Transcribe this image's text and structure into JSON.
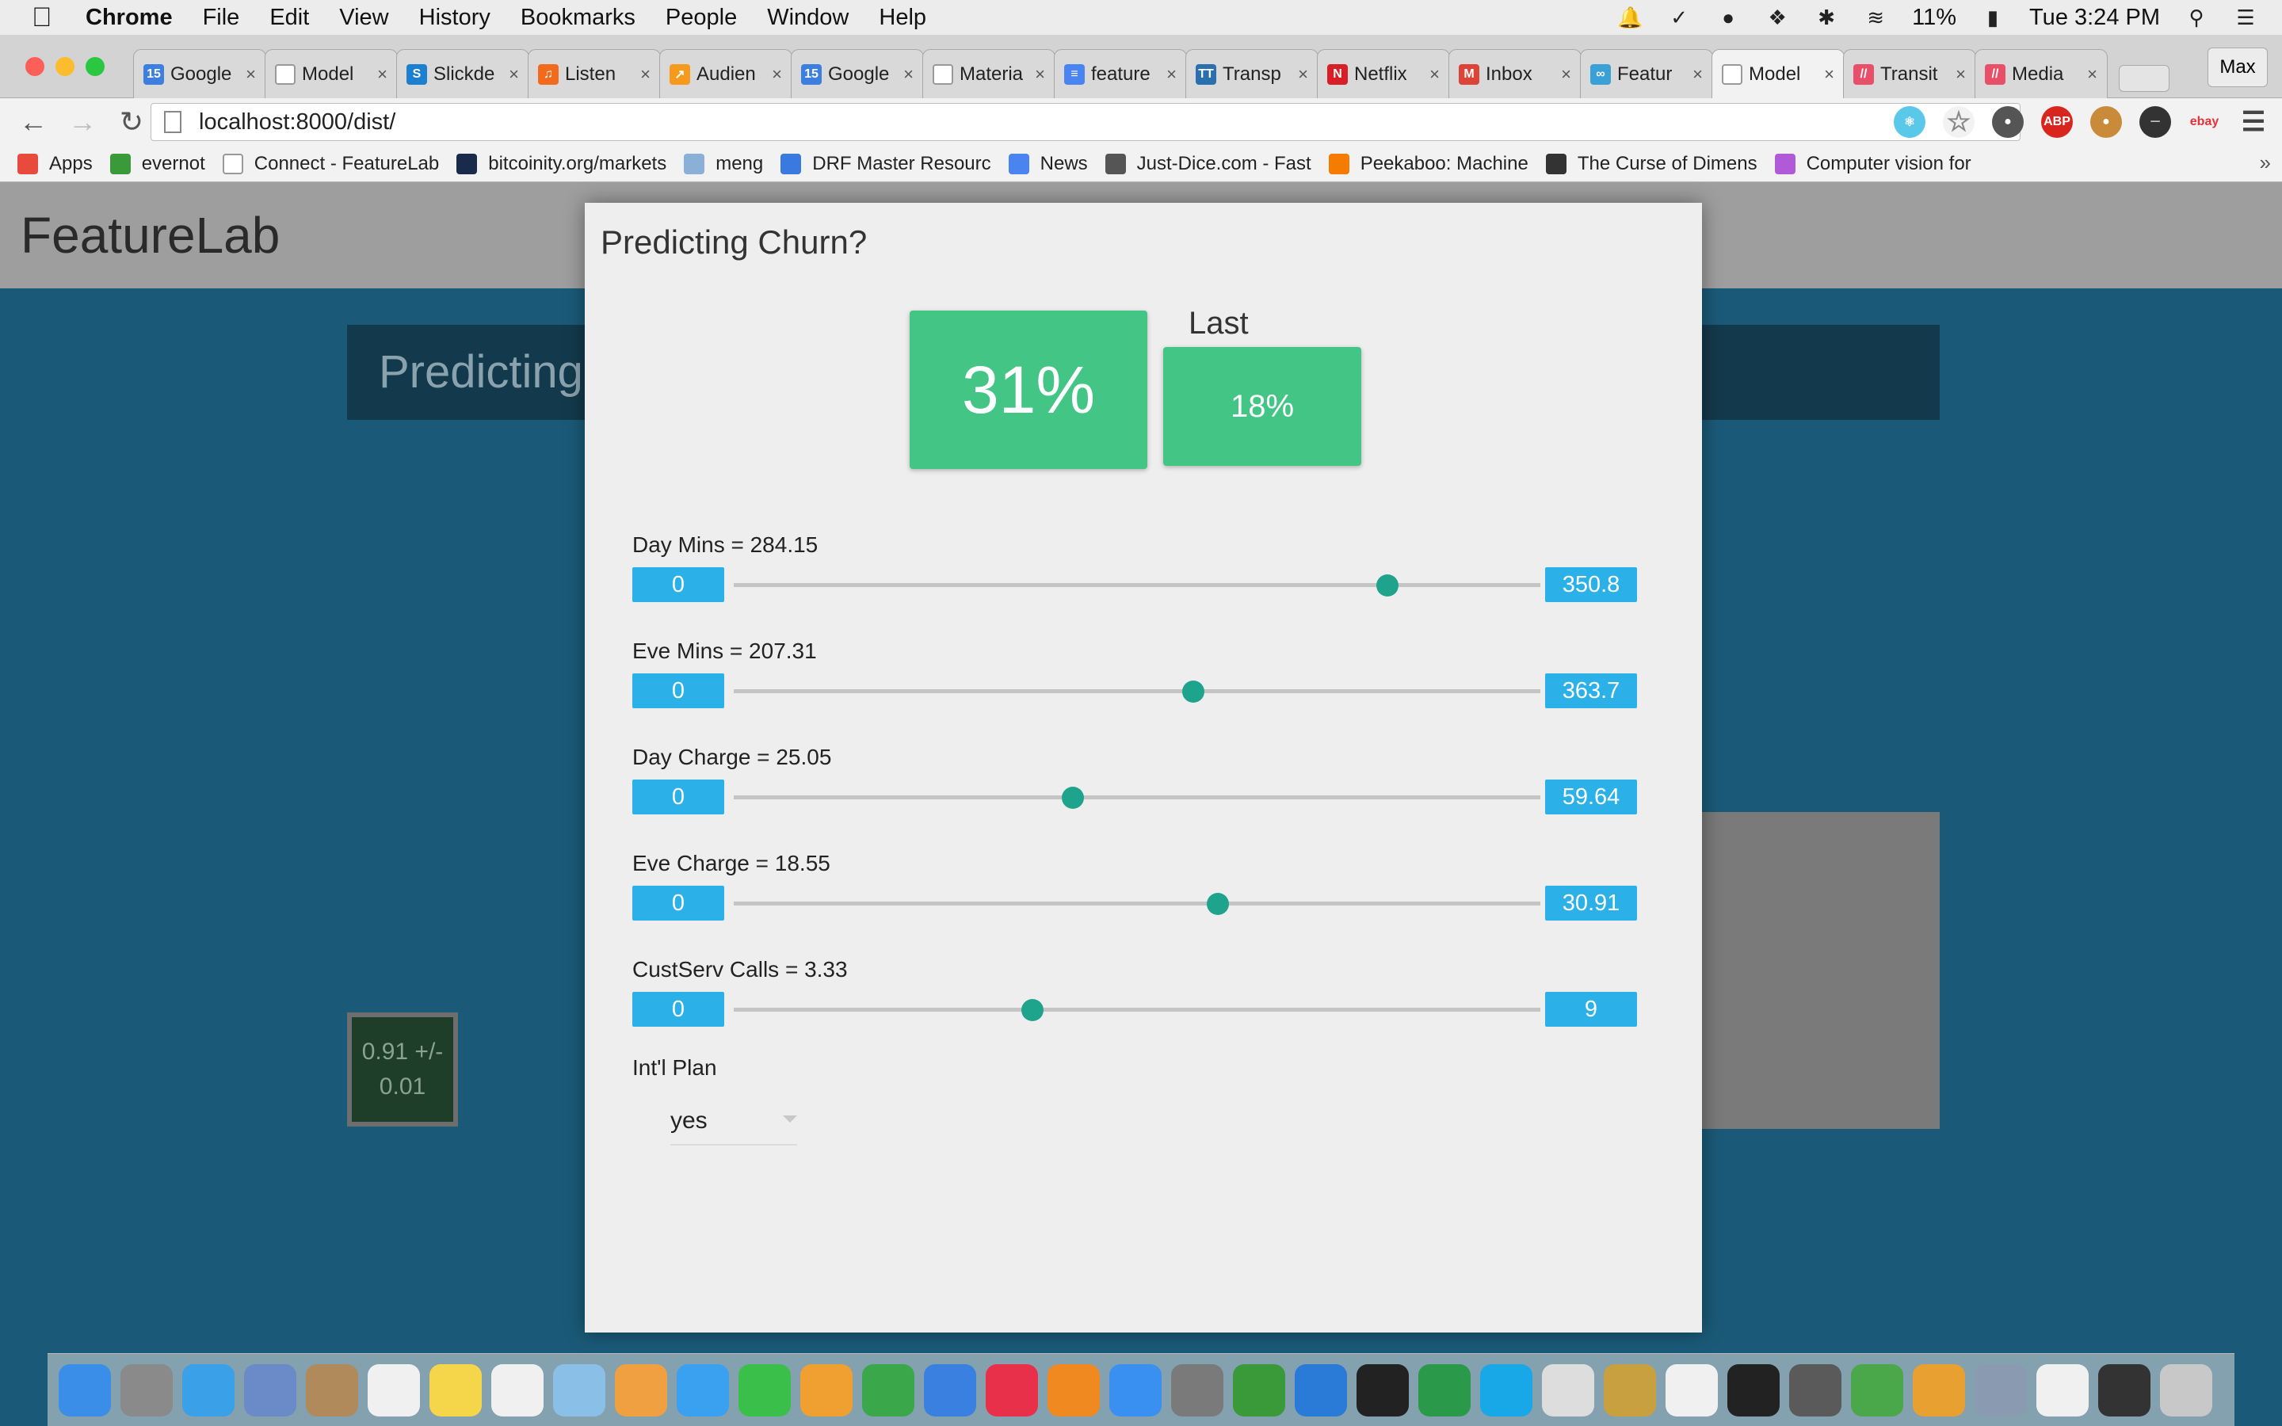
{
  "menubar": {
    "app_name": "Chrome",
    "menus": [
      "File",
      "Edit",
      "View",
      "History",
      "Bookmarks",
      "People",
      "Window",
      "Help"
    ],
    "battery": "11%",
    "clock": "Tue 3:24 PM"
  },
  "tabs": [
    {
      "title": "Google",
      "icon": "calendar-icon",
      "color": "#3d7fe0",
      "glyph": "15"
    },
    {
      "title": "Model",
      "icon": "page-icon",
      "color": "#ffffff",
      "glyph": ""
    },
    {
      "title": "Slickde",
      "icon": "slideshare-icon",
      "color": "#1c7fd0",
      "glyph": "S"
    },
    {
      "title": "Listen",
      "icon": "headphones-icon",
      "color": "#f26a1c",
      "glyph": "♫"
    },
    {
      "title": "Audien",
      "icon": "analytics-icon",
      "color": "#f59a1c",
      "glyph": "↗"
    },
    {
      "title": "Google",
      "icon": "calendar-icon",
      "color": "#3d7fe0",
      "glyph": "15"
    },
    {
      "title": "Materia",
      "icon": "page-icon",
      "color": "#ffffff",
      "glyph": ""
    },
    {
      "title": "feature",
      "icon": "docs-icon",
      "color": "#4a84f0",
      "glyph": "≡"
    },
    {
      "title": "Transp",
      "icon": "transport-icon",
      "color": "#2a6fb0",
      "glyph": "TT"
    },
    {
      "title": "Netflix",
      "icon": "netflix-icon",
      "color": "#d81f26",
      "glyph": "N"
    },
    {
      "title": "Inbox",
      "icon": "gmail-icon",
      "color": "#db4437",
      "glyph": "M"
    },
    {
      "title": "Featur",
      "icon": "link-icon",
      "color": "#3aa0d8",
      "glyph": "∞"
    },
    {
      "title": "Model",
      "icon": "page-icon",
      "color": "#ffffff",
      "glyph": "",
      "active": true
    },
    {
      "title": "Transit",
      "icon": "medium-icon",
      "color": "#e8506a",
      "glyph": "//"
    },
    {
      "title": "Media",
      "icon": "medium-icon",
      "color": "#e8506a",
      "glyph": "//"
    }
  ],
  "profile_name": "Max",
  "address": {
    "url": "localhost:8000/dist/"
  },
  "bookmarks": [
    {
      "label": "Apps",
      "icon": "apps-grid-icon",
      "color": "#e84a3c"
    },
    {
      "label": "evernot",
      "icon": "evernote-icon",
      "color": "#3a9a3a"
    },
    {
      "label": "Connect - FeatureLab",
      "icon": "page-icon",
      "color": "#ffffff"
    },
    {
      "label": "bitcoinity.org/markets",
      "icon": "chart-icon",
      "color": "#1a2a4a"
    },
    {
      "label": "meng",
      "icon": "folder-icon",
      "color": "#8ab0d8"
    },
    {
      "label": "DRF Master Resourc",
      "icon": "layout-icon",
      "color": "#3a7ae0"
    },
    {
      "label": "News",
      "icon": "google-icon",
      "color": "#4a84f0"
    },
    {
      "label": "Just-Dice.com - Fast",
      "icon": "dice-icon",
      "color": "#555555"
    },
    {
      "label": "Peekaboo: Machine",
      "icon": "blogger-icon",
      "color": "#f57c00"
    },
    {
      "label": "The Curse of Dimens",
      "icon": "film-icon",
      "color": "#333333"
    },
    {
      "label": "Computer vision for",
      "icon": "stack-icon",
      "color": "#b05ad8"
    }
  ],
  "page": {
    "brand": "FeatureLab",
    "section_title": "Predicting",
    "metric": {
      "line1": "0.91 +/-",
      "line2": "0.01"
    }
  },
  "modal": {
    "title": "Predicting Churn?",
    "current_prediction": "31%",
    "last_label": "Last",
    "last_prediction": "18%",
    "sliders": [
      {
        "label": "Day Mins = 284.15",
        "min": "0",
        "max": "350.8",
        "value": 284.15,
        "max_value": 350.8
      },
      {
        "label": "Eve Mins = 207.31",
        "min": "0",
        "max": "363.7",
        "value": 207.31,
        "max_value": 363.7
      },
      {
        "label": "Day Charge = 25.05",
        "min": "0",
        "max": "59.64",
        "value": 25.05,
        "max_value": 59.64
      },
      {
        "label": "Eve Charge = 18.55",
        "min": "0",
        "max": "30.91",
        "value": 18.55,
        "max_value": 30.91
      },
      {
        "label": "CustServ Calls = 3.33",
        "min": "0",
        "max": "9",
        "value": 3.33,
        "max_value": 9
      }
    ],
    "intl_plan_label": "Int'l Plan",
    "intl_plan_value": "yes"
  },
  "colors": {
    "accent_green": "#43c585",
    "pill_blue": "#2bb0e8",
    "thumb_teal": "#1ea38d",
    "page_blue": "#1a5a78"
  }
}
